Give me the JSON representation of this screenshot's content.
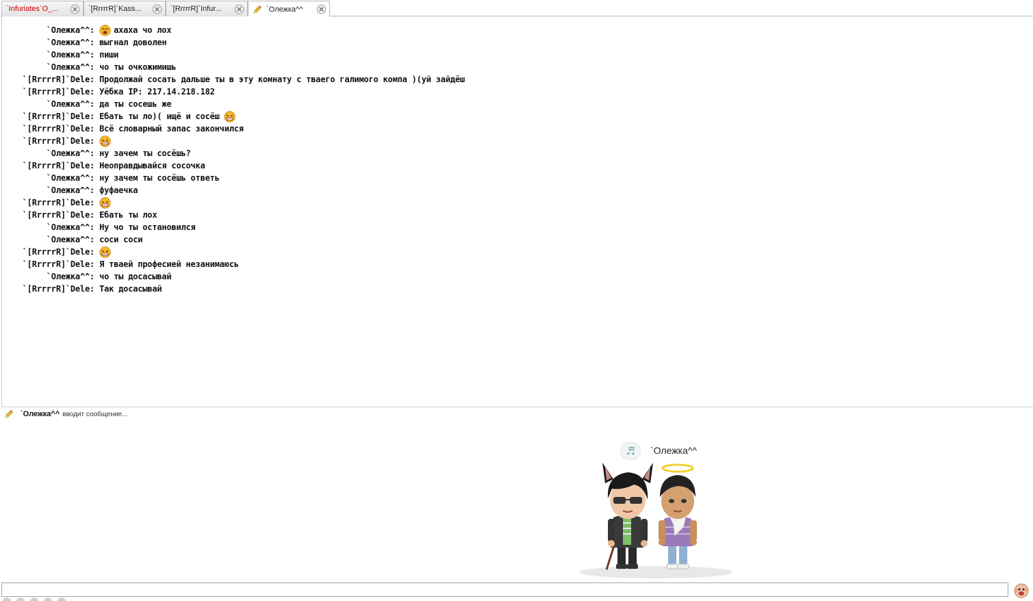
{
  "tabs": [
    {
      "label": "`Infuriates`O_...",
      "color": "#cc0000",
      "active": false
    },
    {
      "label": "`[RrrrrR]`Kass...",
      "color": "#222222",
      "active": false
    },
    {
      "label": "`[RrrrrR]`Infur...",
      "color": "#222222",
      "active": false
    },
    {
      "label": "`Олежка^^",
      "color": "#222222",
      "active": true,
      "icon": "pencil-icon"
    }
  ],
  "chat": {
    "lines": [
      {
        "nick": "`Олежка^^",
        "text": "ахаха чо лох",
        "smiley": "laughing-smiley-icon"
      },
      {
        "nick": "`Олежка^^",
        "text": "выгнал доволен"
      },
      {
        "nick": "`Олежка^^",
        "text": "пиши"
      },
      {
        "nick": "`Олежка^^",
        "text": "чо ты очкожимишь"
      },
      {
        "nick": "`[RrrrrR]`Dele",
        "text": "Продолжай сосать дальше ты в эту комнату с тваего галимого компа )(уй зайдёш"
      },
      {
        "nick": "`[RrrrrR]`Dele",
        "text": "Уёбка IP: 217.14.218.182"
      },
      {
        "nick": "`Олежка^^",
        "text": "да ты сосешь же"
      },
      {
        "nick": "`[RrrrrR]`Dele",
        "text": "Ебать ты ло)( ищё и сосёш",
        "smiley_after": "grin-smiley-icon"
      },
      {
        "nick": "`[RrrrrR]`Dele",
        "text": "Всё словарный запас закончился"
      },
      {
        "nick": "`[RrrrrR]`Dele",
        "text": "",
        "smiley": "grin-smiley-icon"
      },
      {
        "nick": "`Олежка^^",
        "text": "ну зачем ты сосёшь?"
      },
      {
        "nick": "`[RrrrrR]`Dele",
        "text": "Неоправдывайся сосочка"
      },
      {
        "nick": "`Олежка^^",
        "text": "ну зачем ты сосёшь ответь"
      },
      {
        "nick": "`Олежка^^",
        "text": "фуфаечка"
      },
      {
        "nick": "`[RrrrrR]`Dele",
        "text": "",
        "smiley": "grin-smiley-icon"
      },
      {
        "nick": "`[RrrrrR]`Dele",
        "text": "Ебать ты лох"
      },
      {
        "nick": "`Олежка^^",
        "text": "Ну чо ты остановился"
      },
      {
        "nick": "`Олежка^^",
        "text": "соси соси"
      },
      {
        "nick": "`[RrrrrR]`Dele",
        "text": "",
        "smiley": "grin-smiley-icon"
      },
      {
        "nick": "`[RrrrrR]`Dele",
        "text": "Я тваей професией незанимаюсь"
      },
      {
        "nick": "`Олежка^^",
        "text": "чо ты досасывай"
      },
      {
        "nick": "`[RrrrrR]`Dele",
        "text": "Так досасывай"
      }
    ],
    "separator": ": "
  },
  "typing": {
    "nick": "`Олежка^^",
    "text": "вводит сообщение..."
  },
  "scene": {
    "name": "`Олежка^^",
    "bubble_icon": "music-note-icon",
    "bubble_glyph": "♬"
  },
  "input": {
    "value": "",
    "placeholder": ""
  },
  "colors": {
    "tab_alert": "#cc0000",
    "smiley": "#f5b82e",
    "border": "#b8b8b8"
  }
}
